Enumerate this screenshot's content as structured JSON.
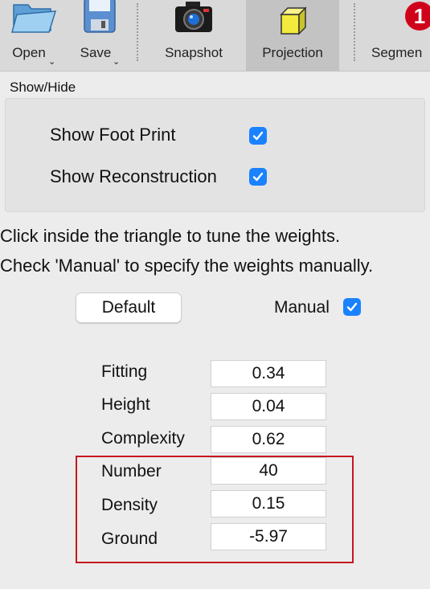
{
  "toolbar": {
    "open_label": "Open",
    "save_label": "Save",
    "snapshot_label": "Snapshot",
    "projection_label": "Projection",
    "segment_label": "Segmen",
    "segment_badge": "1"
  },
  "show_hide": {
    "title": "Show/Hide",
    "footprint_label": "Show Foot Print",
    "footprint_checked": true,
    "reconstruction_label": "Show Reconstruction",
    "reconstruction_checked": true
  },
  "instructions": {
    "line1": "Click inside the triangle to tune the weights.",
    "line2": "Check 'Manual' to specify the weights manually."
  },
  "controls": {
    "default_label": "Default",
    "manual_label": "Manual",
    "manual_checked": true
  },
  "weights": [
    {
      "label": "Fitting",
      "value": "0.34"
    },
    {
      "label": "Height",
      "value": "0.04"
    },
    {
      "label": "Complexity",
      "value": "0.62"
    },
    {
      "label": "Number",
      "value": "40"
    },
    {
      "label": "Density",
      "value": "0.15"
    },
    {
      "label": "Ground",
      "value": "-5.97"
    }
  ],
  "colors": {
    "accent": "#1a82ff",
    "highlight": "#c8161d",
    "badge": "#d0021b"
  }
}
